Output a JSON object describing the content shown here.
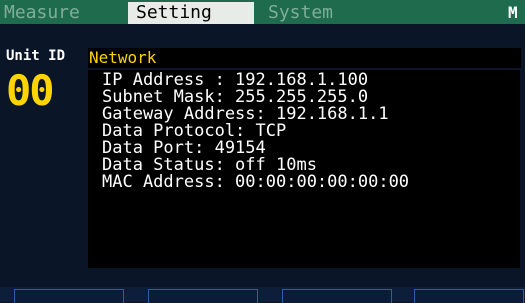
{
  "tabs": [
    {
      "label": "Measure",
      "active": false
    },
    {
      "label": "Setting",
      "active": true
    },
    {
      "label": "System",
      "active": false
    }
  ],
  "status_mark": "M",
  "unit": {
    "label": "Unit ID",
    "value": "00"
  },
  "panel": {
    "title": "Network",
    "rows": [
      "IP Address : 192.168.1.100",
      "Subnet Mask: 255.255.255.0",
      "Gateway Address: 192.168.1.1",
      "Data Protocol: TCP",
      "Data Port: 49154",
      "Data Status: off 10ms",
      "MAC Address: 00:00:00:00:00:00"
    ]
  },
  "softkeys": [
    "",
    "",
    "",
    ""
  ],
  "colors": {
    "tabbar": "#1f6b4e",
    "active_tab": "#e8ece8",
    "accent": "#ffd400",
    "panel": "#000000",
    "background": "#0a1628"
  }
}
